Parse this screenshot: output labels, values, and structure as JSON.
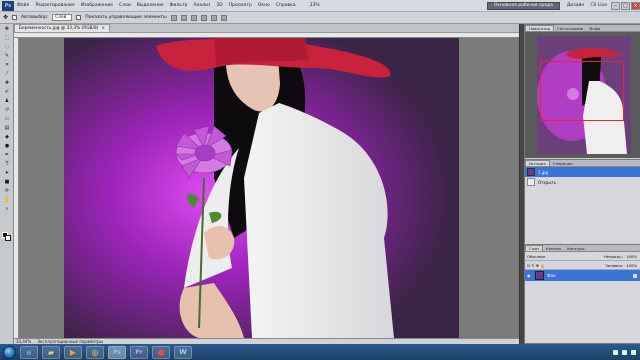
{
  "menubar": {
    "logo": "Ps",
    "items": [
      "Файл",
      "Редактирование",
      "Изображение",
      "Слои",
      "Выделение",
      "Фильтр",
      "Анализ",
      "3D",
      "Просмотр",
      "Окно",
      "Справка"
    ],
    "zoom": "33%",
    "workspace_button": "Основная рабочая среда",
    "design_link": "Дизайн",
    "cs_live": "CS Live"
  },
  "options": {
    "auto_select_label": "Автовыбор:",
    "auto_select_value": "Слой",
    "show_controls_label": "Показать управляющие элементы"
  },
  "document": {
    "tab_title": "Беременность.jpg @ 33,3% (RGB/8)"
  },
  "status": {
    "zoom": "33,44%",
    "info": "Эксплуатационные параметры"
  },
  "navigator": {
    "tabs": [
      "Навигатор",
      "Гистограмма",
      "Инфо"
    ],
    "zoom": "33,44%",
    "zoom_fraction": 0.65
  },
  "history": {
    "tabs": [
      "История",
      "Операции"
    ],
    "items": [
      "1.jpg",
      "Открыть"
    ]
  },
  "layers": {
    "tabs": [
      "Слои",
      "Каналы",
      "Контуры"
    ],
    "blend_mode": "Обычные",
    "opacity_label": "Непрозр.:",
    "opacity": "100%",
    "fill_label": "Заливка:",
    "fill": "100%",
    "items": [
      "Фон"
    ]
  },
  "taskbar": {
    "apps": [
      "start",
      "ie",
      "explorer",
      "media",
      "chrome",
      "photoshop",
      "premiere",
      "app-red",
      "word"
    ]
  },
  "colors": {
    "accent": "#3875d7",
    "background_purple": "#b830d8",
    "hat": "#c8223c"
  }
}
